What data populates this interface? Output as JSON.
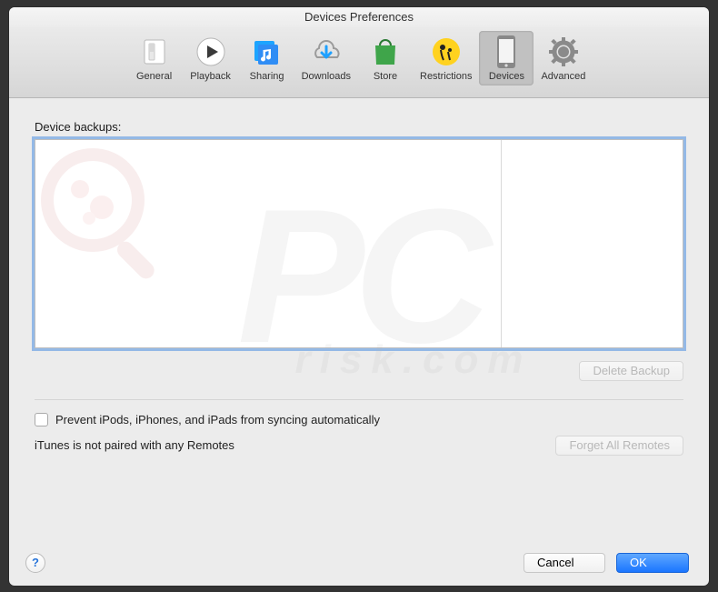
{
  "window": {
    "title": "Devices Preferences"
  },
  "toolbar": {
    "items": [
      {
        "label": "General"
      },
      {
        "label": "Playback"
      },
      {
        "label": "Sharing"
      },
      {
        "label": "Downloads"
      },
      {
        "label": "Store"
      },
      {
        "label": "Restrictions"
      },
      {
        "label": "Devices"
      },
      {
        "label": "Advanced"
      }
    ],
    "selected_index": 6
  },
  "main": {
    "backups_label": "Device backups:",
    "delete_backup": "Delete Backup",
    "prevent_sync": "Prevent iPods, iPhones, and iPads from syncing automatically",
    "paired_status": "iTunes is not paired with any Remotes",
    "forget_remotes": "Forget All Remotes"
  },
  "footer": {
    "help": "?",
    "cancel": "Cancel",
    "ok": "OK"
  },
  "watermark": {
    "big": "PC",
    "sub": "risk.com"
  }
}
